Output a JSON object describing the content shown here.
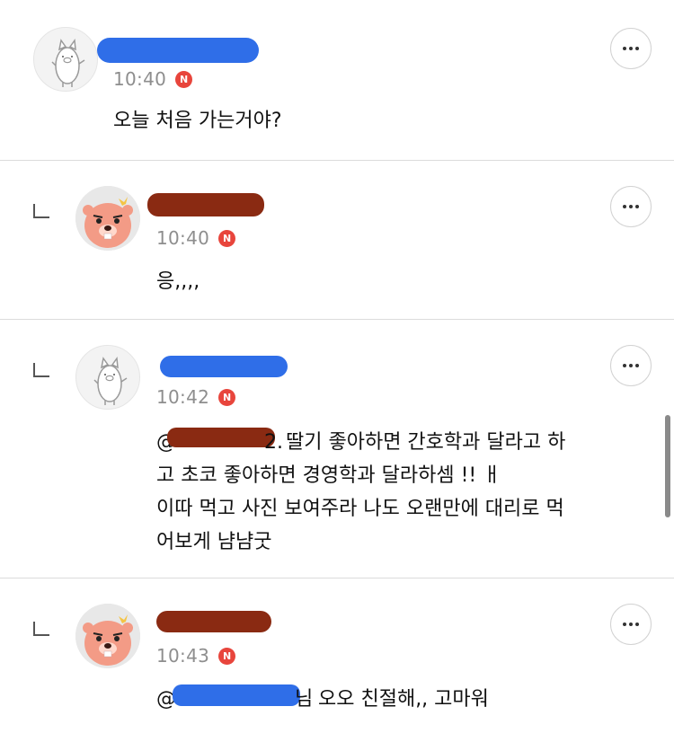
{
  "comments": [
    {
      "author": "",
      "time": "10:40",
      "new_badge": "N",
      "text": "오늘 처음 가는거야?",
      "avatar": "pig-character-icon",
      "is_reply": false
    },
    {
      "author": "",
      "time": "10:40",
      "new_badge": "N",
      "text": "응,,,,",
      "avatar": "beaver-character-icon",
      "is_reply": true
    },
    {
      "author": "",
      "time": "10:42",
      "new_badge": "N",
      "mention_prefix": "@",
      "mention_suffix": "2.",
      "text_line1": "딸기 좋아하면 간호학과 달라고 하",
      "text_rest": "고 초코 좋아하면 경영학과 달라하셈 !! ㅐ\n이따 먹고 사진 보여주라 나도 오랜만에 대리로 먹\n어보게 냠냠굿",
      "avatar": "pig-character-icon",
      "is_reply": true
    },
    {
      "author": "",
      "time": "10:43",
      "new_badge": "N",
      "mention_prefix": "@",
      "mention_suffix": "님",
      "text": "오오 친절해,, 고마워",
      "avatar": "beaver-character-icon",
      "is_reply": true
    }
  ],
  "colors": {
    "redaction_blue": "#2f6ee8",
    "redaction_red": "#8a2a12",
    "badge": "#e8453c",
    "time": "#8e8e8e"
  }
}
